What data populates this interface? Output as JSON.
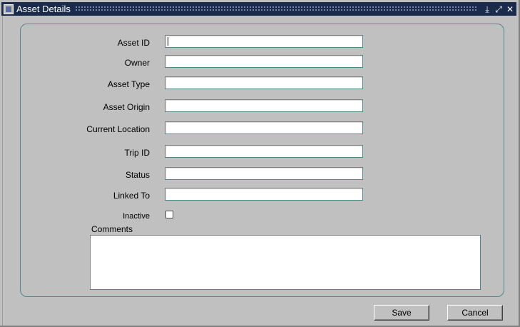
{
  "window": {
    "title": "Asset Details",
    "controls": {
      "minimize": "⤓",
      "maximize": "⤢",
      "close": "✕"
    }
  },
  "form": {
    "asset_id": {
      "label": "Asset ID",
      "value": ""
    },
    "owner": {
      "label": "Owner",
      "value": ""
    },
    "asset_type": {
      "label": "Asset Type",
      "value": ""
    },
    "asset_origin": {
      "label": "Asset Origin",
      "value": ""
    },
    "current_location": {
      "label": "Current Location",
      "value": ""
    },
    "trip_id": {
      "label": "Trip ID",
      "value": ""
    },
    "status": {
      "label": "Status",
      "value": ""
    },
    "linked_to": {
      "label": "Linked To",
      "value": ""
    },
    "inactive": {
      "label": "Inactive",
      "checked": false
    },
    "comments": {
      "label": "Comments",
      "value": ""
    }
  },
  "buttons": {
    "save": "Save",
    "cancel": "Cancel"
  },
  "colors": {
    "titlebar": "#1a2b4c",
    "frame_border": "#4a8a8a",
    "background": "#c0c0c0"
  }
}
